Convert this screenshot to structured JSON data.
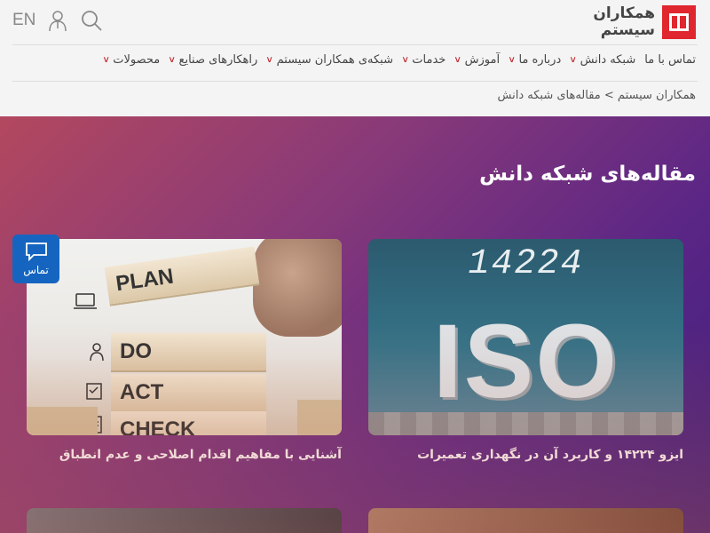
{
  "header": {
    "logo_line1": "همکاران",
    "logo_line2": "سیستم",
    "lang": "EN",
    "icons": [
      "user-icon",
      "search-icon"
    ]
  },
  "nav": {
    "items": [
      {
        "label": "محصولات"
      },
      {
        "label": "راهکارهای صنایع"
      },
      {
        "label": "شبکه‌ی همکاران سیستم"
      },
      {
        "label": "خدمات"
      },
      {
        "label": "آموزش"
      },
      {
        "label": "درباره ما"
      },
      {
        "label": "شبکه دانش"
      },
      {
        "label": "تماس با ما"
      }
    ]
  },
  "breadcrumb": "همکاران سیستم > مقاله‌های شبکه دانش",
  "main": {
    "title": "مقاله‌های شبکه دانش",
    "cards": [
      {
        "title": "ایزو ۱۴۲۲۴ و کاربرد آن در نگهداری تعمیرات",
        "image_text_top": "14224",
        "image_text_main": "ISO"
      },
      {
        "title": "آشنایی با مفاهیم اقدام اصلاحی و عدم انطباق",
        "blocks": [
          "PLAN",
          "DO",
          "ACT",
          "CHECK"
        ]
      }
    ]
  },
  "contact_fab": {
    "label": "تماس"
  },
  "colors": {
    "brand_red": "#e0262e",
    "fab_blue": "#1565c0",
    "nav_chevron": "#c0262e"
  }
}
